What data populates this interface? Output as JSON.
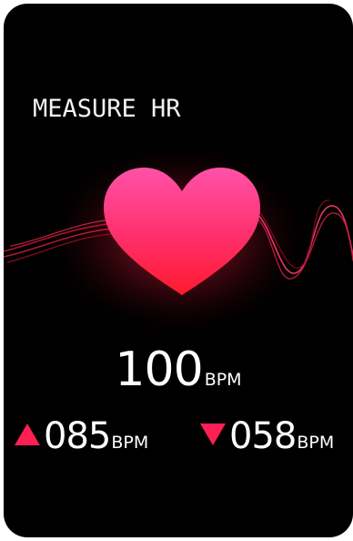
{
  "title": "MEASURE HR",
  "current": {
    "value": "100",
    "unit": "BPM"
  },
  "max": {
    "value": "085",
    "unit": "BPM"
  },
  "min": {
    "value": "058",
    "unit": "BPM"
  },
  "icons": {
    "heart": "heart-icon",
    "max": "triangle-up-icon",
    "min": "triangle-down-icon"
  },
  "colors": {
    "background": "#000000",
    "accent": "#ff1f55",
    "heart_top": "#ff4fa3",
    "heart_bottom": "#ff1a2e",
    "text": "#ffffff"
  }
}
